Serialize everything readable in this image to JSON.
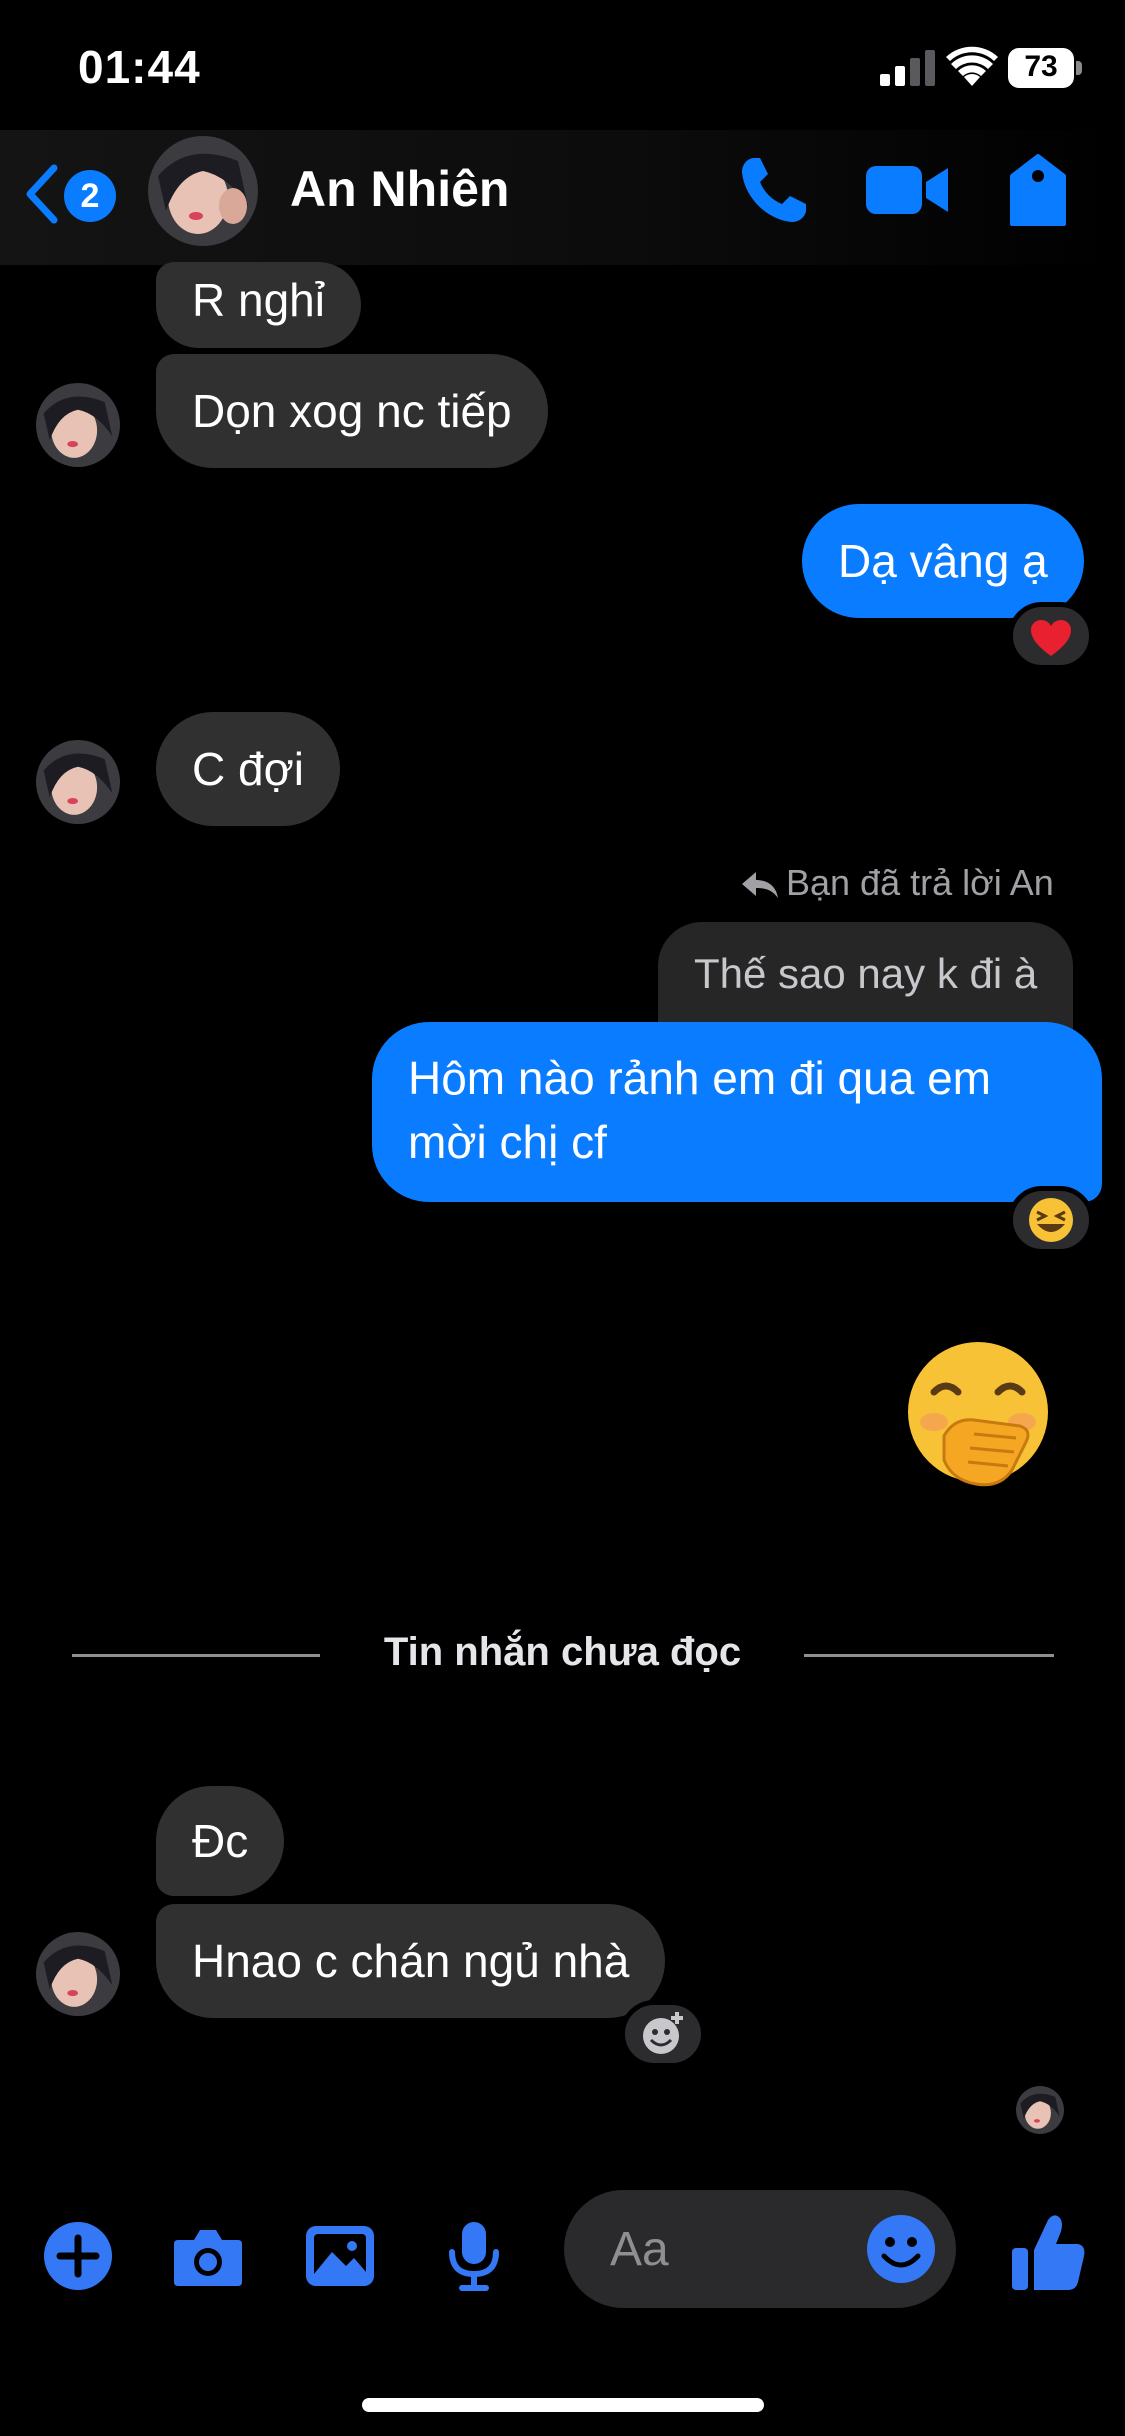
{
  "status_bar": {
    "time": "01:44",
    "battery": "73"
  },
  "header": {
    "back_badge": "2",
    "contact_name": "An Nhiên"
  },
  "messages": {
    "m1": "R nghỉ",
    "m2": "Dọn xog nc tiếp",
    "m3": "Dạ vâng ạ",
    "m4": "C đợi",
    "reply_note": "Bạn đã trả lời An",
    "reply_quote": "Thế sao nay k đi à",
    "m5_line1": "Hôm nào rảnh em đi qua em",
    "m5_line2": "mời chị cf",
    "unread_divider": "Tin nhắn chưa đọc",
    "m6": "Đc",
    "m7": "Hnao c chán ngủ nhà"
  },
  "reactions": {
    "heart": "heart-reaction",
    "laugh": "laughing-reaction",
    "add": "add-reaction"
  },
  "composer": {
    "placeholder": "Aa"
  },
  "colors": {
    "accent": "#0a7cff",
    "incoming_bubble": "#303030",
    "background": "#000000"
  }
}
